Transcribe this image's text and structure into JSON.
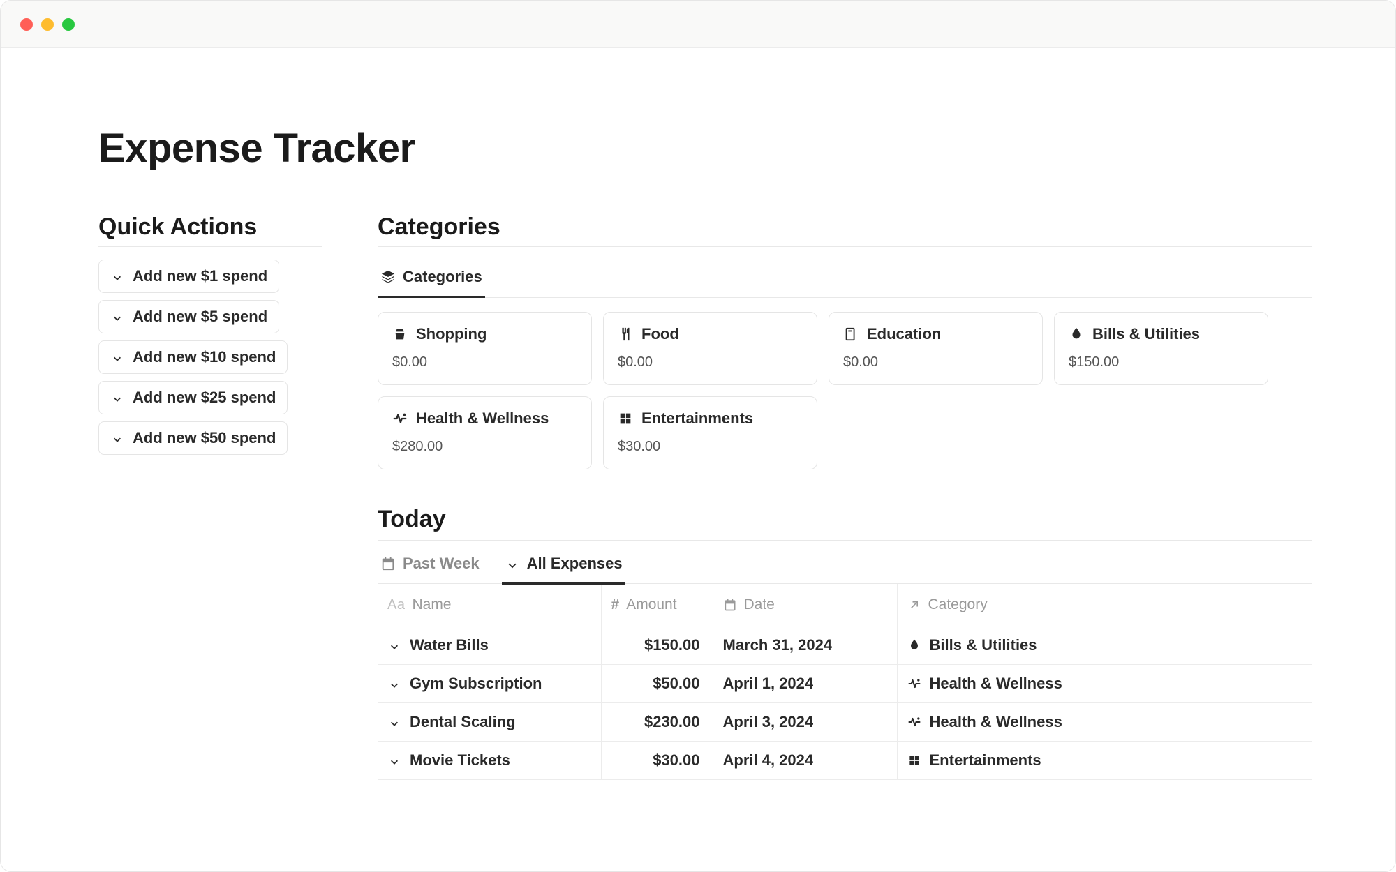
{
  "page_title": "Expense Tracker",
  "quick_actions": {
    "heading": "Quick Actions",
    "items": [
      {
        "label": "Add new $1 spend"
      },
      {
        "label": "Add new $5 spend"
      },
      {
        "label": "Add new $10 spend"
      },
      {
        "label": "Add new $25 spend"
      },
      {
        "label": "Add new $50 spend"
      }
    ]
  },
  "categories": {
    "heading": "Categories",
    "tab_label": "Categories",
    "items": [
      {
        "icon": "shopping",
        "name": "Shopping",
        "amount": "$0.00"
      },
      {
        "icon": "food",
        "name": "Food",
        "amount": "$0.00"
      },
      {
        "icon": "education",
        "name": "Education",
        "amount": "$0.00"
      },
      {
        "icon": "bills",
        "name": "Bills & Utilities",
        "amount": "$150.00"
      },
      {
        "icon": "health",
        "name": "Health & Wellness",
        "amount": "$280.00"
      },
      {
        "icon": "entertainment",
        "name": "Entertainments",
        "amount": "$30.00"
      }
    ]
  },
  "today": {
    "heading": "Today",
    "tabs": [
      {
        "id": "past_week",
        "label": "Past Week",
        "icon": "calendar",
        "active": false
      },
      {
        "id": "all_expenses",
        "label": "All Expenses",
        "icon": "down-arrow",
        "active": true
      }
    ],
    "columns": {
      "name": "Name",
      "amount": "Amount",
      "date": "Date",
      "category": "Category"
    },
    "rows": [
      {
        "name": "Water Bills",
        "amount": "$150.00",
        "date": "March 31, 2024",
        "cat_icon": "bills",
        "category": "Bills & Utilities"
      },
      {
        "name": "Gym Subscription",
        "amount": "$50.00",
        "date": "April 1, 2024",
        "cat_icon": "health",
        "category": "Health & Wellness"
      },
      {
        "name": "Dental Scaling",
        "amount": "$230.00",
        "date": "April 3, 2024",
        "cat_icon": "health",
        "category": "Health & Wellness"
      },
      {
        "name": "Movie Tickets",
        "amount": "$30.00",
        "date": "April 4, 2024",
        "cat_icon": "entertainment",
        "category": "Entertainments"
      }
    ]
  }
}
